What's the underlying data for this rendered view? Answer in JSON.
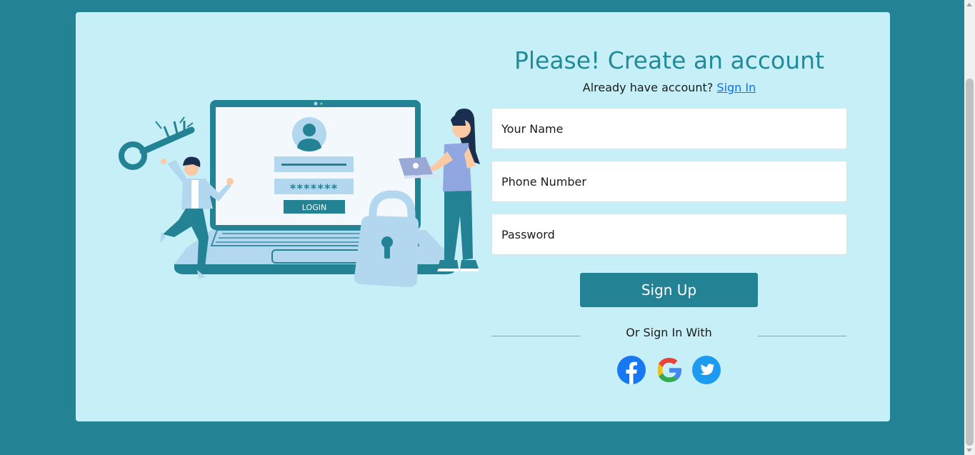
{
  "form": {
    "title": "Please! Create an account",
    "have_account_text": "Already have account?",
    "sign_in_link": "Sign In",
    "name_placeholder": "Your Name",
    "phone_placeholder": "Phone Number",
    "password_placeholder": "Password",
    "signup_button": "Sign Up",
    "or_sign_in_with": "Or Sign In With"
  },
  "illustration": {
    "login_button_text": "LOGIN",
    "password_mask": "*******"
  },
  "social": [
    "facebook-icon",
    "google-icon",
    "twitter-icon"
  ],
  "colors": {
    "page_background": "#238394",
    "card_background": "#c6eff8",
    "accent": "#238394",
    "title": "#228b99",
    "link": "#0d6efd"
  }
}
